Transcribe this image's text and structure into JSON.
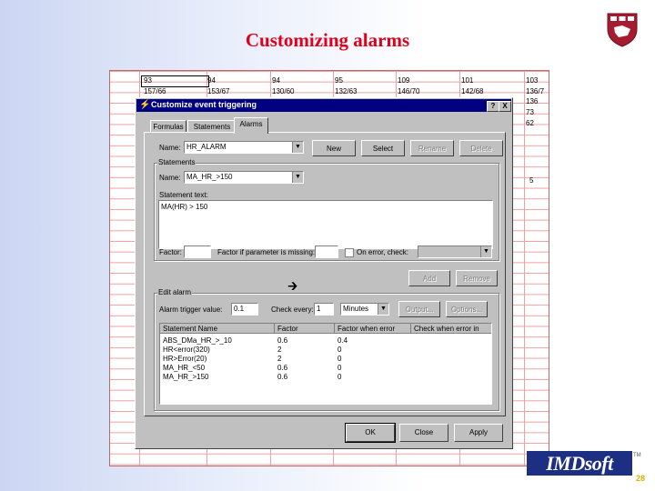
{
  "slide": {
    "title": "Customizing alarms",
    "logo_text": "IMDsoft",
    "tm": "TM",
    "page_number": "28"
  },
  "spreadsheet": {
    "rows": [
      [
        "93",
        "94",
        "94",
        "95",
        "109",
        "101",
        "103"
      ],
      [
        "157/66",
        "153/67",
        "130/60",
        "132/63",
        "146/70",
        "142/68",
        "136/7"
      ],
      [
        "",
        "",
        "",
        "",
        "",
        "",
        "136"
      ],
      [
        "",
        "",
        "",
        "",
        "",
        "",
        "73"
      ],
      [
        "",
        "",
        "",
        "",
        "",
        "",
        "62"
      ]
    ],
    "side_value": "5"
  },
  "dialog": {
    "title": "Customize event triggering",
    "help_btn": "?",
    "close_btn": "X",
    "tabs": [
      "Formulas",
      "Statements",
      "Alarms"
    ],
    "name_label": "Name:",
    "name_value": "HR_ALARM",
    "buttons_top": [
      "New",
      "Select",
      "Rename",
      "Delete"
    ],
    "statements_group": "Statements",
    "stmt_name_label": "Name:",
    "stmt_name_value": "MA_HR_>150",
    "stmt_text_label": "Statement text:",
    "stmt_text_value": "MA(HR) > 150",
    "factor_label": "Factor:",
    "factor_missing_label": "Factor if parameter is missing:",
    "on_error_label": "On error, check:",
    "add_btn": "Add",
    "remove_btn": "Remove",
    "edit_alarm_group": "Edit alarm",
    "trigger_label": "Alarm trigger value:",
    "trigger_value": "0.1",
    "check_every_label": "Check every:",
    "check_every_value": "1",
    "unit_value": "Minutes",
    "output_btn": "Output...",
    "options_btn": "Options...",
    "table_headers": [
      "Statement Name",
      "Factor",
      "Factor when error",
      "Check when error in"
    ],
    "table_rows": [
      [
        "ABS_DMa_HR_>_10",
        "0.6",
        "0.4",
        ""
      ],
      [
        "HR<error(320)",
        "2",
        "0",
        ""
      ],
      [
        "HR>Error(20)",
        "2",
        "0",
        ""
      ],
      [
        "MA_HR_<50",
        "0.6",
        "0",
        ""
      ],
      [
        "MA_HR_>150",
        "0.6",
        "0",
        ""
      ]
    ],
    "ok_btn": "OK",
    "close_bottom_btn": "Close",
    "apply_btn": "Apply"
  }
}
